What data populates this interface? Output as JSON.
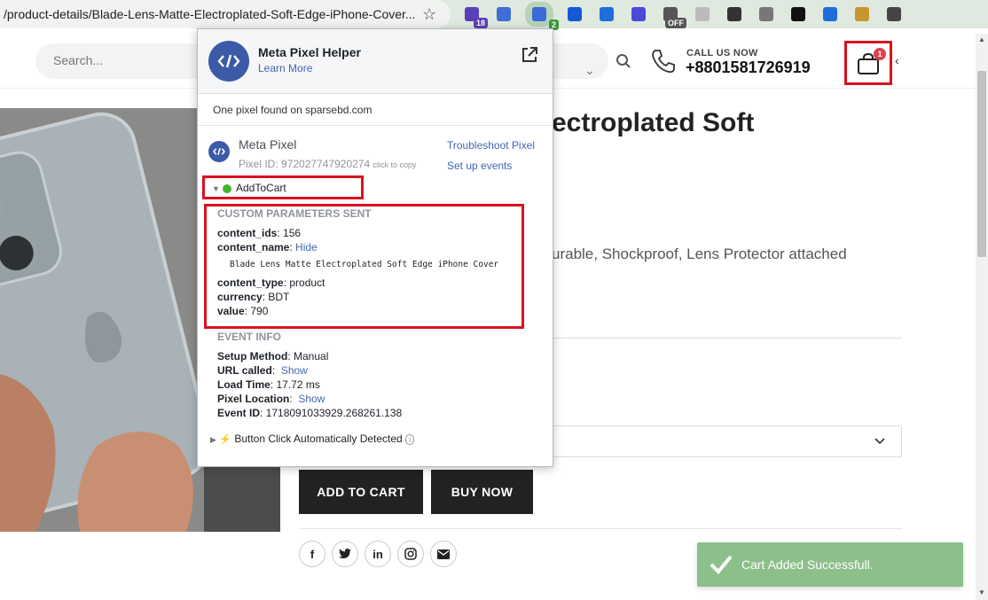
{
  "browser": {
    "url": "/product-details/Blade-Lens-Matte-Electroplated-Soft-Edge-iPhone-Cover...",
    "extensions": [
      {
        "name": "calendar-ext-icon",
        "color": "#5b3fb6",
        "badge": "18",
        "badge_color": "#5b3fb6"
      },
      {
        "name": "reader-ext-icon",
        "color": "#3d6fd6",
        "badge": "",
        "badge_color": ""
      },
      {
        "name": "pixel-helper-ext-icon",
        "color": "#3b6ad8",
        "badge": "2",
        "badge_color": "#3c9a3c"
      },
      {
        "name": "layers-ext-icon",
        "color": "#1458d6",
        "badge": "",
        "badge_color": ""
      },
      {
        "name": "eye-ext-icon",
        "color": "#1e6fd9",
        "badge": "",
        "badge_color": ""
      },
      {
        "name": "gear-ext-icon",
        "color": "#4a4ad6",
        "badge": "",
        "badge_color": ""
      },
      {
        "name": "off-ext-icon",
        "color": "#555555",
        "badge": "OFF",
        "badge_color": "#555555"
      },
      {
        "name": "link-ext-icon",
        "color": "#bbbbbb",
        "badge": "",
        "badge_color": ""
      },
      {
        "name": "qr-ext-icon",
        "color": "#333333",
        "badge": "",
        "badge_color": ""
      },
      {
        "name": "globe-ext-icon",
        "color": "#777777",
        "badge": "",
        "badge_color": ""
      },
      {
        "name": "ghost-ext-icon",
        "color": "#111111",
        "badge": "",
        "badge_color": ""
      },
      {
        "name": "tag-ext-icon",
        "color": "#1f6fd6",
        "badge": "",
        "badge_color": ""
      },
      {
        "name": "person-ext-icon",
        "color": "#c8962e",
        "badge": "",
        "badge_color": ""
      },
      {
        "name": "puzzle-icon",
        "color": "#444444",
        "badge": "",
        "badge_color": ""
      }
    ]
  },
  "header": {
    "search_placeholder": "Search...",
    "call_label": "CALL US NOW",
    "phone": "+8801581726919",
    "cart_count": "1"
  },
  "product": {
    "title_fragment": "ectroplated Soft",
    "desc_fragment": "urable, Shockproof, Lens Protector attached",
    "add_to_cart": "ADD TO CART",
    "buy_now": "BUY NOW"
  },
  "toast": {
    "text": "Cart Added Successfull."
  },
  "pixel_helper": {
    "title": "Meta Pixel Helper",
    "learn_more": "Learn More",
    "found_text": "One pixel found on sparsebd.com",
    "pixel_name": "Meta Pixel",
    "pixel_id_label": "Pixel ID:",
    "pixel_id": "972027747920274",
    "click_to_copy": "click to copy",
    "troubleshoot": "Troubleshoot Pixel",
    "setup_events": "Set up events",
    "event_name": "AddToCart",
    "custom_params_title": "CUSTOM PARAMETERS SENT",
    "content_ids_key": "content_ids",
    "content_ids_val": "156",
    "content_name_key": "content_name",
    "hide_link": "Hide",
    "content_name_val": "Blade Lens Matte Electroplated Soft Edge iPhone Cover",
    "content_type_key": "content_type",
    "content_type_val": "product",
    "currency_key": "currency",
    "currency_val": "BDT",
    "value_key": "value",
    "value_val": "790",
    "event_info_title": "EVENT INFO",
    "setup_method_key": "Setup Method",
    "setup_method_val": "Manual",
    "url_called_key": "URL called",
    "show_link": "Show",
    "load_time_key": "Load Time",
    "load_time_val": "17.72 ms",
    "pixel_location_key": "Pixel Location",
    "event_id_key": "Event ID",
    "event_id_val": "1718091033929.268261.138",
    "auto_detected": "Button Click Automatically Detected"
  }
}
